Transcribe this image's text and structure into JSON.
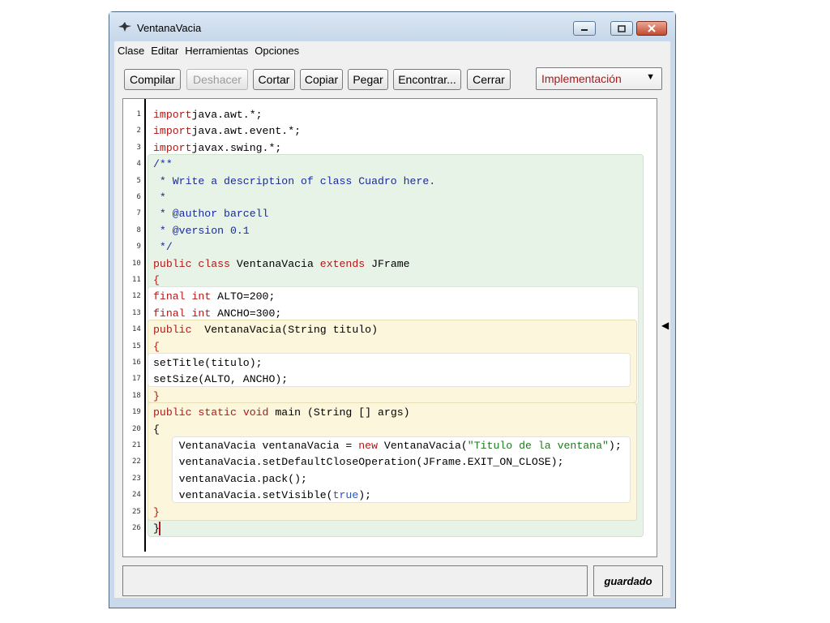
{
  "window": {
    "title": "VentanaVacia"
  },
  "menu": [
    "Clase",
    "Editar",
    "Herramientas",
    "Opciones"
  ],
  "toolbar": {
    "compile": "Compilar",
    "undo": "Deshacer",
    "cut": "Cortar",
    "copy": "Copiar",
    "paste": "Pegar",
    "find": "Encontrar...",
    "close": "Cerrar",
    "view_select": "Implementación"
  },
  "editor": {
    "line_numbers": [
      "1",
      "2",
      "3",
      "4",
      "5",
      "6",
      "7",
      "8",
      "9",
      "10",
      "11",
      "12",
      "13",
      "14",
      "15",
      "16",
      "17",
      "18",
      "19",
      "20",
      "21",
      "22",
      "23",
      "24",
      "25",
      "26"
    ],
    "lines": [
      [
        [
          "kw",
          "import"
        ],
        [
          "",
          "java.awt.*;"
        ]
      ],
      [
        [
          "kw",
          "import"
        ],
        [
          "",
          "java.awt.event.*;"
        ]
      ],
      [
        [
          "kw",
          "import"
        ],
        [
          "",
          "javax.swing.*;"
        ]
      ],
      [
        [
          "cm",
          "/**"
        ]
      ],
      [
        [
          "cm",
          " * Write a description of class Cuadro here."
        ]
      ],
      [
        [
          "cm",
          " *"
        ]
      ],
      [
        [
          "cm",
          " * @author barcell"
        ]
      ],
      [
        [
          "cm",
          " * @version 0.1"
        ]
      ],
      [
        [
          "cm",
          " */"
        ]
      ],
      [
        [
          "kw",
          "public"
        ],
        [
          "",
          " "
        ],
        [
          "kw",
          "class"
        ],
        [
          "",
          " VentanaVacia "
        ],
        [
          "kw",
          "extends"
        ],
        [
          "",
          " JFrame"
        ]
      ],
      [
        [
          "kw",
          "{"
        ]
      ],
      [
        [
          "kw",
          "final"
        ],
        [
          "",
          " "
        ],
        [
          "kw",
          "int"
        ],
        [
          "",
          " ALTO=200;"
        ]
      ],
      [
        [
          "kw",
          "final"
        ],
        [
          "",
          " "
        ],
        [
          "kw",
          "int"
        ],
        [
          "",
          " ANCHO=300;"
        ]
      ],
      [
        [
          "kw",
          "public"
        ],
        [
          "",
          "  VentanaVacia(String titulo)"
        ]
      ],
      [
        [
          "kw",
          "{"
        ]
      ],
      [
        [
          "",
          "setTitle(titulo);"
        ]
      ],
      [
        [
          "",
          "setSize(ALTO, ANCHO);"
        ]
      ],
      [
        [
          "kw",
          "}"
        ]
      ],
      [
        [
          "kw",
          "public"
        ],
        [
          "",
          " "
        ],
        [
          "kw",
          "static"
        ],
        [
          "",
          " "
        ],
        [
          "kw",
          "void"
        ],
        [
          "",
          " main (String [] args)"
        ]
      ],
      [
        [
          "",
          "{"
        ]
      ],
      [
        [
          "",
          "    VentanaVacia ventanaVacia = "
        ],
        [
          "kw",
          "new"
        ],
        [
          "",
          " VentanaVacia("
        ],
        [
          "str",
          "\"Titulo de la ventana\""
        ],
        [
          "",
          ");"
        ]
      ],
      [
        [
          "",
          "    ventanaVacia.setDefaultCloseOperation(JFrame.EXIT_ON_CLOSE);"
        ]
      ],
      [
        [
          "",
          "    ventanaVacia.pack();"
        ]
      ],
      [
        [
          "",
          "    ventanaVacia.setVisible("
        ],
        [
          "lit",
          "true"
        ],
        [
          "",
          ");"
        ]
      ],
      [
        [
          "kw",
          "}"
        ]
      ],
      [
        [
          "",
          "}"
        ]
      ]
    ]
  },
  "status": {
    "message": "",
    "saved_label": "guardado"
  }
}
